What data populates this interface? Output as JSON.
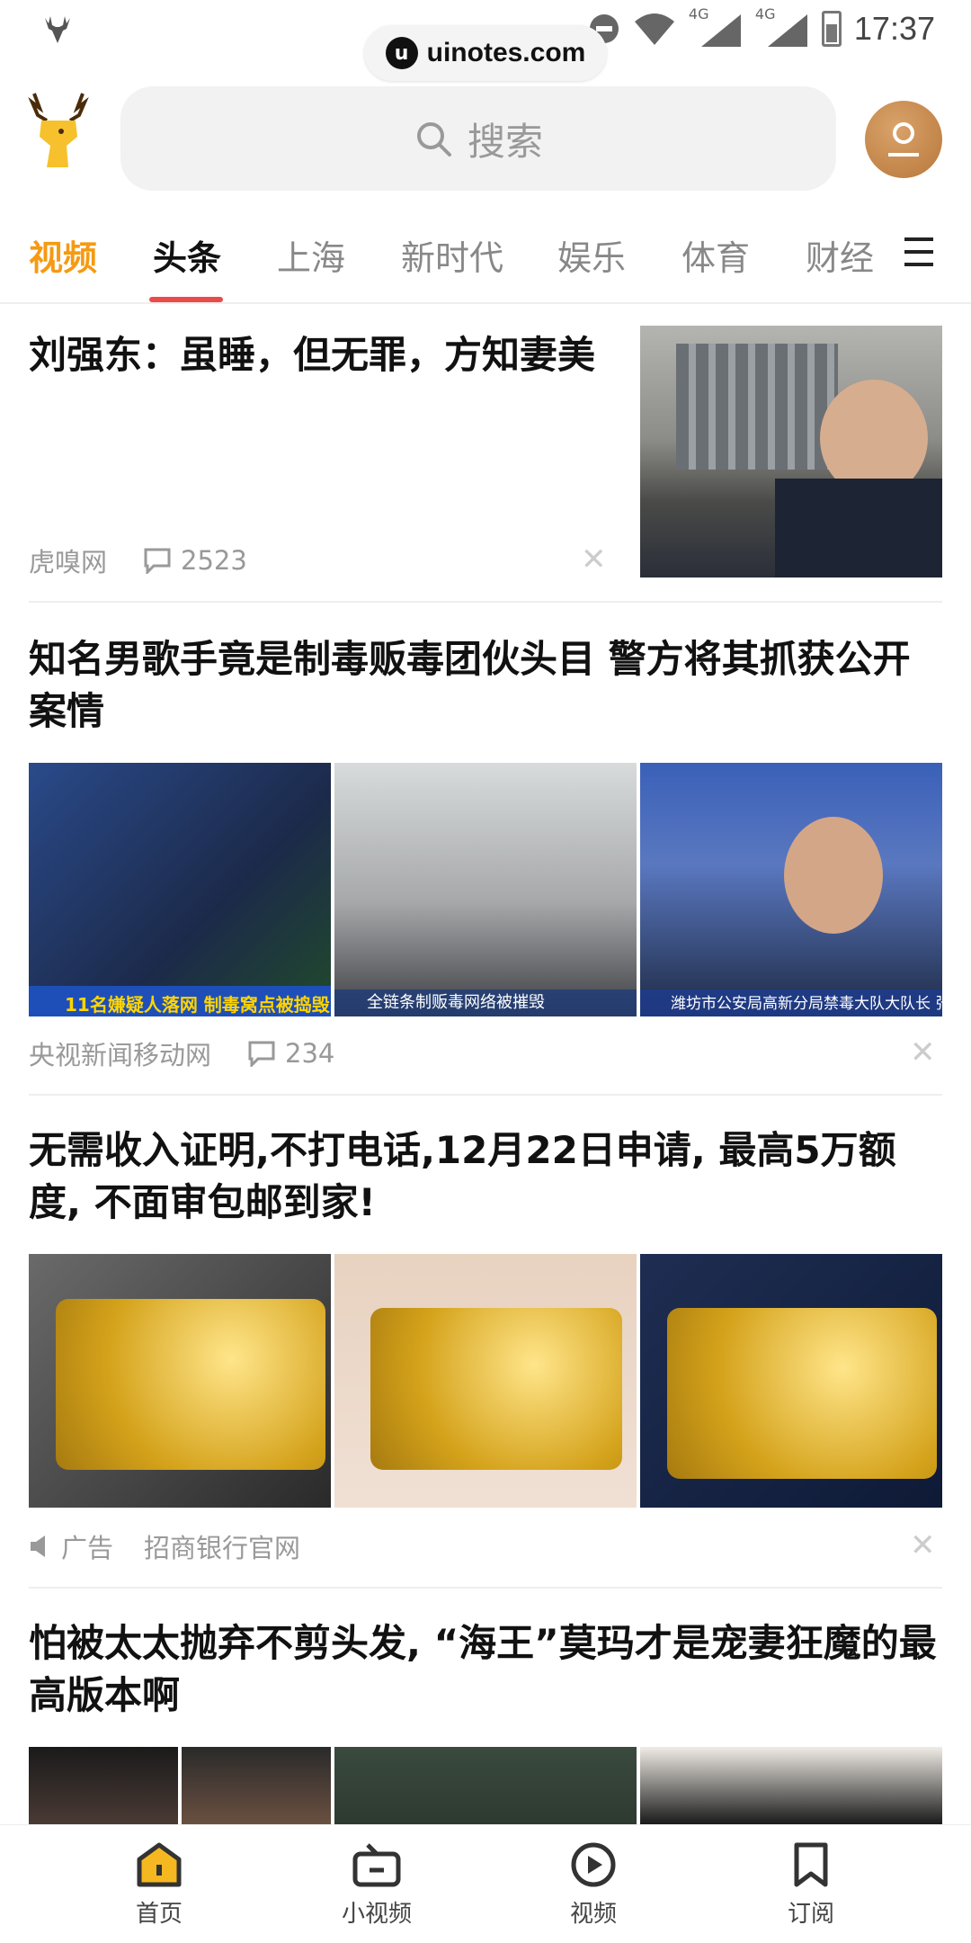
{
  "status_bar": {
    "time": "17:37",
    "signal_1_label": "4G",
    "signal_2_label": "4G"
  },
  "watermark": {
    "text": "uinotes.com"
  },
  "search": {
    "placeholder": "搜索"
  },
  "tabs": [
    "视频",
    "头条",
    "上海",
    "新时代",
    "娱乐",
    "体育",
    "财经"
  ],
  "active_tab": "头条",
  "articles": [
    {
      "title": "刘强东：虽睡，但无罪，方知妻美",
      "source": "虎嗅网",
      "comments": "2523"
    },
    {
      "title": "知名男歌手竟是制毒贩毒团伙头目 警方将其抓获公开案情",
      "source": "央视新闻移动网",
      "comments": "234",
      "image_captions": [
        "11名嫌疑人落网 制毒窝点被捣毁",
        "全链条制贩毒网络被摧毁",
        "潍坊市公安局高新分局禁毒大队大队长 张"
      ]
    },
    {
      "title": "无需收入证明,不打电话,12月22日申请, 最高5万额度, 不面审包邮到家!",
      "ad_label": "广告",
      "source": "招商银行官网"
    },
    {
      "title": "怕被太太抛弃不剪头发, “海王”莫玛才是宠妻狂魔的最高版本啊"
    }
  ],
  "bottom_nav": [
    "首页",
    "小视频",
    "视频",
    "订阅"
  ],
  "colors": {
    "accent": "#f59a12",
    "tab_underline": "#e94b4b"
  }
}
